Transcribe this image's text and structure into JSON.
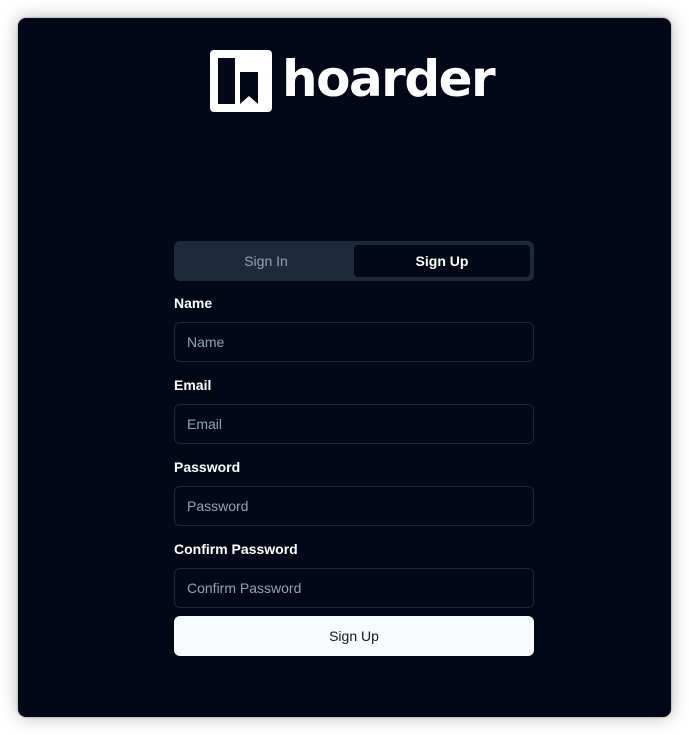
{
  "app": {
    "logo_text": "hoarder",
    "logo_icon": "bookmark-logo-icon"
  },
  "tabs": [
    {
      "label": "Sign In",
      "active": false
    },
    {
      "label": "Sign Up",
      "active": true
    }
  ],
  "fields": {
    "name": {
      "label": "Name",
      "placeholder": "Name",
      "value": ""
    },
    "email": {
      "label": "Email",
      "placeholder": "Email",
      "value": ""
    },
    "password": {
      "label": "Password",
      "placeholder": "Password",
      "value": ""
    },
    "confirm_password": {
      "label": "Confirm Password",
      "placeholder": "Confirm Password",
      "value": ""
    }
  },
  "submit_label": "Sign Up",
  "colors": {
    "background": "#020817",
    "tab_bar": "#1e293b",
    "primary_button": "#f8fafc",
    "muted_text": "#94a3b8"
  }
}
